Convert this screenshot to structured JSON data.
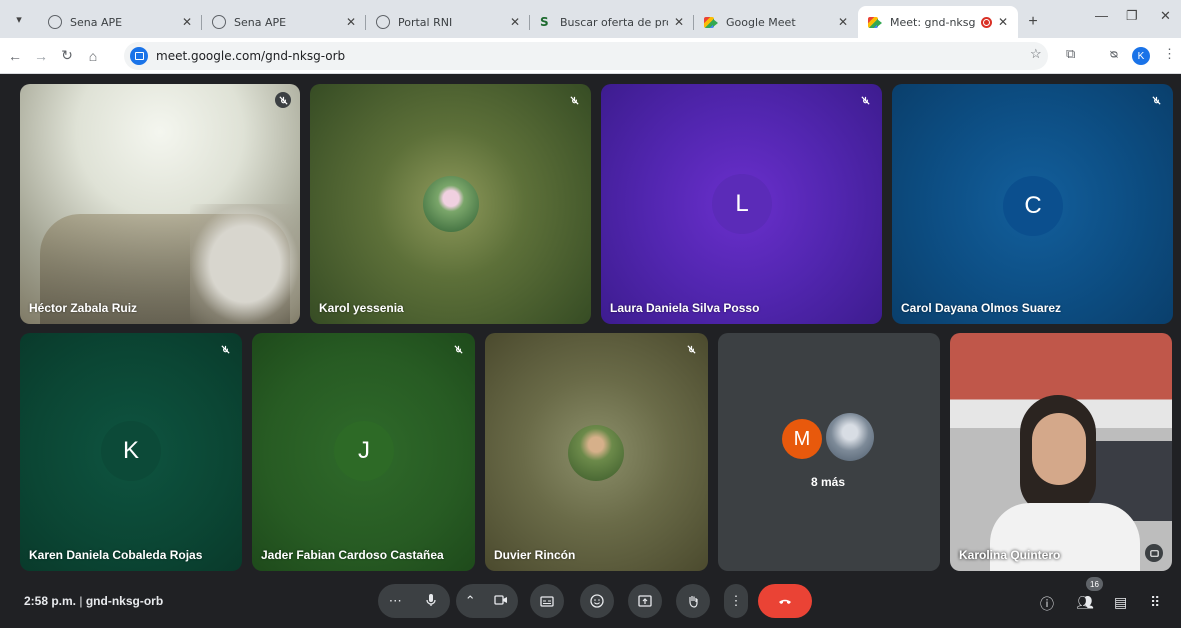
{
  "browser": {
    "tabs": [
      {
        "title": "Sena APE"
      },
      {
        "title": "Sena APE"
      },
      {
        "title": "Portal RNI"
      },
      {
        "title": "Buscar oferta de programa"
      },
      {
        "title": "Google Meet"
      },
      {
        "title": "Meet: gnd-nksg-orb"
      }
    ],
    "url": "meet.google.com/gnd-nksg-orb",
    "profile_initial": "K"
  },
  "participants": [
    {
      "name": "Héctor Zabala Ruiz"
    },
    {
      "name": "Karol yessenia"
    },
    {
      "name": "Laura Daniela Silva Posso",
      "initial": "L"
    },
    {
      "name": "Carol Dayana Olmos Suarez",
      "initial": "C"
    },
    {
      "name": "Karen Daniela Cobaleda Rojas",
      "initial": "K"
    },
    {
      "name": "Jader Fabian Cardoso Castañea",
      "initial": "J"
    },
    {
      "name": "Duvier Rincón"
    },
    {
      "name": "Karolina Quintero"
    }
  ],
  "more_tile": {
    "initial": "M",
    "label": "8 más"
  },
  "bottom": {
    "time": "2:58 p.m.",
    "meeting_code": "gnd-nksg-orb",
    "participant_count": "16"
  },
  "colors": {
    "end_call": "#ea4335",
    "accent": "#1a73e8"
  }
}
